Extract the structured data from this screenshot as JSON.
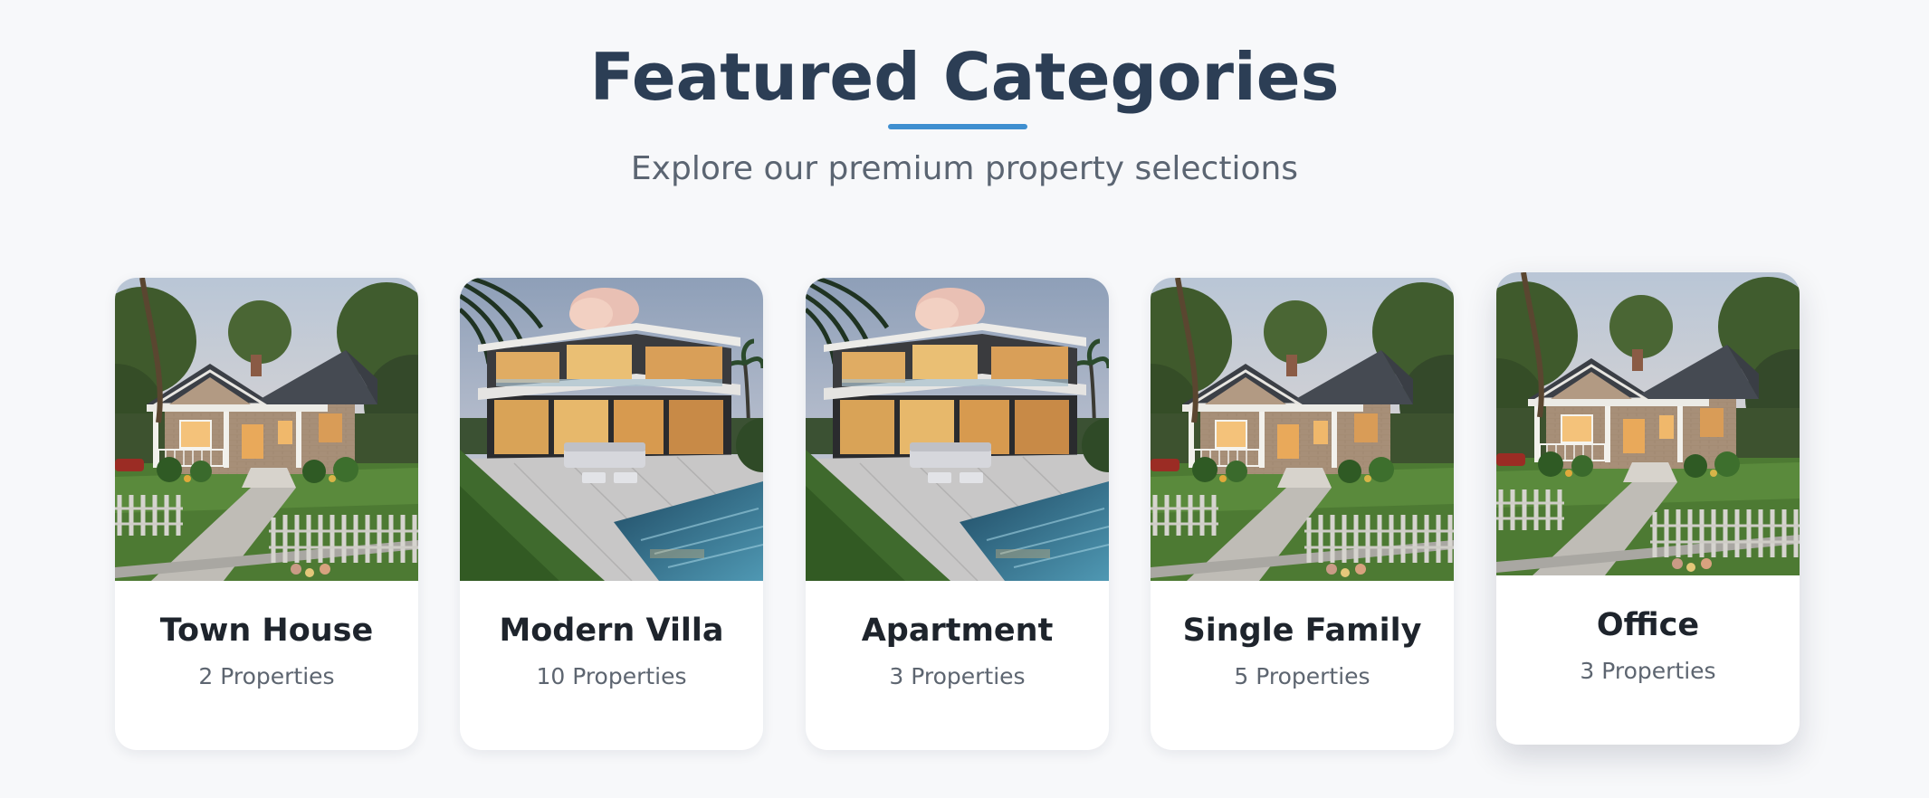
{
  "header": {
    "title": "Featured Categories",
    "subtitle": "Explore our premium property selections"
  },
  "colors": {
    "title": "#2c3e55",
    "accent_underline": "#3f8fd0",
    "subtitle": "#5b6572",
    "card_title": "#1e242c",
    "card_count": "#5d6570",
    "page_background": "#f7f8fa"
  },
  "categories": [
    {
      "name": "Town House",
      "count": "2 Properties",
      "image": "cottage-house-photo"
    },
    {
      "name": "Modern Villa",
      "count": "10 Properties",
      "image": "modern-villa-pool-photo"
    },
    {
      "name": "Apartment",
      "count": "3 Properties",
      "image": "modern-villa-pool-photo"
    },
    {
      "name": "Single Family",
      "count": "5 Properties",
      "image": "cottage-house-photo"
    },
    {
      "name": "Office",
      "count": "3 Properties",
      "image": "cottage-house-photo",
      "hovered": true
    }
  ]
}
